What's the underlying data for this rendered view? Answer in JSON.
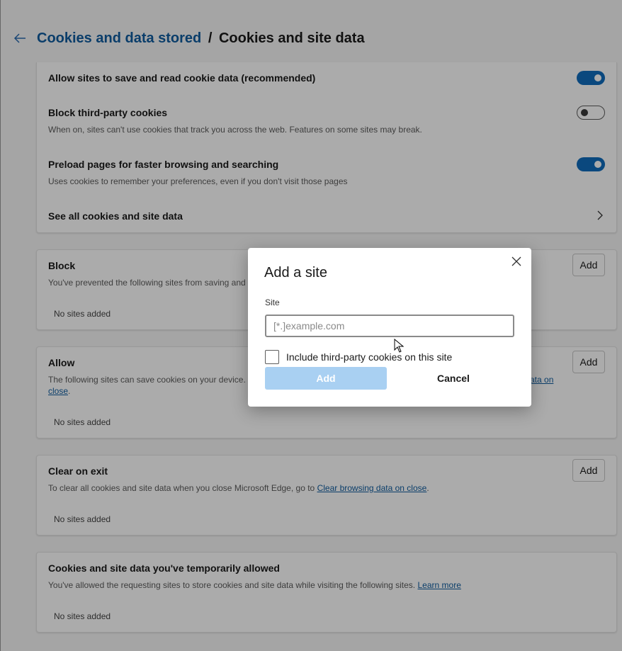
{
  "header": {
    "parent_link": "Cookies and data stored",
    "separator": "/",
    "current": "Cookies and site data"
  },
  "settings": {
    "allow_save": {
      "label": "Allow sites to save and read cookie data (recommended)",
      "state": "on"
    },
    "block_third_party": {
      "label": "Block third-party cookies",
      "description": "When on, sites can't use cookies that track you across the web. Features on some sites may break.",
      "state": "off"
    },
    "preload": {
      "label": "Preload pages for faster browsing and searching",
      "description": "Uses cookies to remember your preferences, even if you don't visit those pages",
      "state": "on"
    },
    "see_all": {
      "label": "See all cookies and site data"
    }
  },
  "sections": {
    "block": {
      "title": "Block",
      "description": "You've prevented the following sites from saving and",
      "add_label": "Add",
      "empty": "No sites added"
    },
    "allow": {
      "title": "Allow",
      "description_line1": "The following sites can save cookies on your device. T",
      "link_end": "ata on",
      "link_line2": "close",
      "description_line2_end": ".",
      "add_label": "Add",
      "empty": "No sites added"
    },
    "clear_on_exit": {
      "title": "Clear on exit",
      "description": "To clear all cookies and site data when you close Microsoft Edge, go to",
      "link": "Clear browsing data on close",
      "description_end": ".",
      "add_label": "Add",
      "empty": "No sites added"
    },
    "temporary": {
      "title": "Cookies and site data you've temporarily allowed",
      "description": "You've allowed the requesting sites to store cookies and site data while visiting the following sites.",
      "link": "Learn more",
      "empty": "No sites added"
    }
  },
  "dialog": {
    "title": "Add a site",
    "field_label": "Site",
    "placeholder": "[*.]example.com",
    "checkbox_label": "Include third-party cookies on this site",
    "add_label": "Add",
    "cancel_label": "Cancel"
  },
  "colors": {
    "accent": "#0f6cbd",
    "link": "#0f5c9e",
    "disabled_button": "#a9d0f2"
  }
}
